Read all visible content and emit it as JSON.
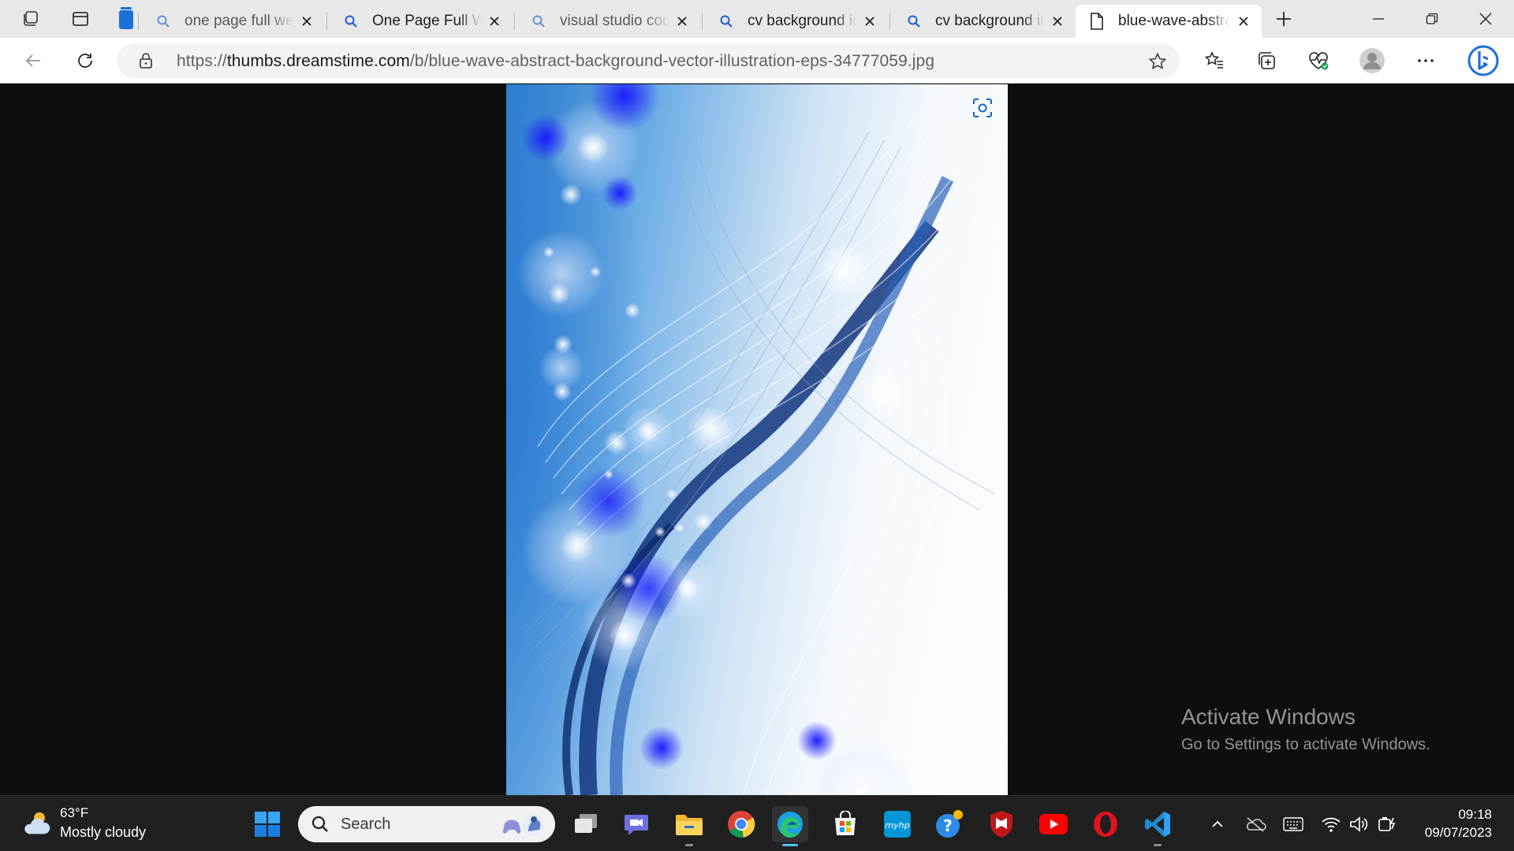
{
  "browser": {
    "tabs": [
      {
        "title": "one page full web",
        "favicon": "search-icon",
        "active": false
      },
      {
        "title": "One Page Full We",
        "favicon": "search-icon",
        "active": false
      },
      {
        "title": "visual studio code",
        "favicon": "search-icon",
        "active": false
      },
      {
        "title": "cv background im",
        "favicon": "search-icon",
        "active": false
      },
      {
        "title": "cv background im",
        "favicon": "search-icon",
        "active": false
      },
      {
        "title": "blue-wave-abstra",
        "favicon": "page-icon",
        "active": true
      }
    ],
    "url_scheme": "https://",
    "url_host": "thumbs.dreamstime.com",
    "url_path": "/b/blue-wave-abstract-background-vector-illustration-eps-34777059.jpg"
  },
  "overlay": {
    "line1": "Activate Windows",
    "line2": "Go to Settings to activate Windows."
  },
  "taskbar": {
    "weather_temp": "63°F",
    "weather_condition": "Mostly cloudy",
    "search_label": "Search",
    "time": "09:18",
    "date": "09/07/2023",
    "accent": "#4cc2ff"
  }
}
